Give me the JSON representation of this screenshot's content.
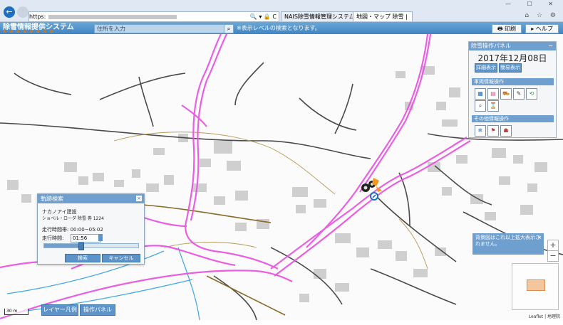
{
  "browser": {
    "back_icon": "←",
    "address": "https:",
    "address_icons": "🔍 ▾ 🔒 C",
    "tabs": [
      {
        "label": "NAIS除雪情報管理システム..."
      },
      {
        "label": "地図・マップ 除雪 |"
      }
    ],
    "tools": "⌂ ☆ ⚙",
    "window_controls": "— ☐ ✕"
  },
  "app": {
    "title": "除雪情報提供システム",
    "search_placeholder": "住所を入力",
    "search_button": "⌕",
    "notice": "※表示レベルの検索となります。",
    "print_label": "印刷",
    "help_label": "ヘルプ"
  },
  "panel": {
    "title": "除雪操作パネル",
    "minimize": "−",
    "date": "2017年12月08日",
    "detail_button": "詳細表示",
    "simple_button": "簡易表示",
    "section_vehicle": "車両情報操作",
    "section_other": "その他情報操作"
  },
  "dialog": {
    "title": "軌跡検索",
    "close": "×",
    "company": "ナカノアイ建設",
    "vehicle": "ショベル・ローダ 除雪 券 1224",
    "range": "走行時間帯: 00:00~05:02",
    "time_label": "走行時間:",
    "time_value": "01:56",
    "slider_fraction": 0.39,
    "search_button": "検索",
    "cancel_button": "キャンセル"
  },
  "toast": {
    "message": "背景図はこれ以上拡大表示されません。",
    "close": "×"
  },
  "map": {
    "zoom_in": "+",
    "zoom_out": "−",
    "scale": "30 m",
    "attribution": "Leaflet | 地理院",
    "layer_button": "レイヤー凡例 ⇄",
    "ops_button": "操作パネル ⇄"
  },
  "colors": {
    "header": "#4a8ccb",
    "panel_header": "#6f9fce",
    "track": "#e84fe0",
    "river": "#4aa8e8",
    "road_main": "#8a6a2a"
  }
}
